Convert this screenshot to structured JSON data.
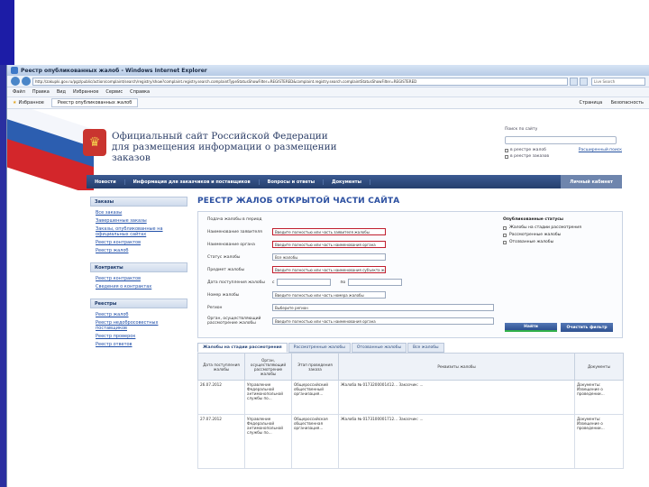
{
  "window": {
    "title": "Реестр опубликованных жалоб - Windows Internet Explorer",
    "address": "http://zakupki.gov.ru/pgz/public/action/complaint/search/registry/show?complaint.registry.search.complaintTypeStatusShowFilter=REGISTERED&complaint.registry.search.complaintStatusShowFilter=REGISTERED",
    "search_placeholder": "Live Search"
  },
  "menu": [
    "Файл",
    "Правка",
    "Вид",
    "Избранное",
    "Сервис",
    "Справка"
  ],
  "favbar": {
    "favorites": "Избранное",
    "tab": "Реестр опубликованных жалоб",
    "tools": [
      "Страница",
      "Безопасность"
    ]
  },
  "header": {
    "site_title": "Официальный сайт Российской Федерации для размещения информации о размещении заказов",
    "search_label": "Поиск по сайту",
    "opt1": "в реестре жалоб",
    "opt2": "в реестре заказов",
    "advanced_link": "Расширенный поиск"
  },
  "topnav": {
    "items": [
      "Новости",
      "Информация для заказчиков и поставщиков",
      "Вопросы и ответы",
      "Документы"
    ],
    "login": "Личный кабинет"
  },
  "sidebar": {
    "orders_head": "Заказы",
    "orders_links": [
      "Все заказы",
      "Завершенные заказы",
      "Заказы, опубликованные на официальных сайтах",
      "Реестр контрактов",
      "Реестр жалоб"
    ],
    "contracts_head": "Контракты",
    "contracts_links": [
      "Реестр контрактов",
      "Сведения о контрактах"
    ],
    "registries_head": "Реестры",
    "registries_links": [
      "Реестр жалоб",
      "Реестр недобросовестных поставщиков",
      "Реестр проверок",
      "Реестр ответов"
    ]
  },
  "main": {
    "title": "РЕЕСТР ЖАЛОБ ОТКРЫТОЙ ЧАСТИ САЙТА",
    "form": {
      "period_label": "Подача жалобы в период",
      "complainant_label": "Наименование заявителя",
      "complainant_value": "Введите полностью или часть заявителя жалобы",
      "authority_label": "Наименование органа",
      "authority_value": "Введите полностью или часть наименования органа",
      "status_label": "Статус жалобы",
      "status_value": "Все жалобы",
      "subject_label": "Предмет жалобы",
      "subject_value": "Введите полностью или часть наименования субъекта жалобы",
      "date_label": "Дата поступления жалобы",
      "date_from": "с",
      "date_to": "по",
      "number_label": "Номер жалобы",
      "number_value": "Введите полностью или часть номера жалобы",
      "region_label": "Регион",
      "region_value": "Выберите регион",
      "organ_label": "Орган, осуществляющий рассмотрение жалобы",
      "organ_value": "Введите полностью или часть наименования органа"
    },
    "status_panel": {
      "title": "Опубликованные статусы",
      "options": [
        "Жалобы на стадии рассмотрения",
        "Рассмотренные жалобы",
        "Отозванные жалобы"
      ]
    },
    "buttons": {
      "find": "Найти",
      "clear": "Очистить фильтр"
    },
    "tabs": [
      "Жалобы на стадии рассмотрения",
      "Рассмотренные жалобы",
      "Отозванные жалобы",
      "Все жалобы"
    ],
    "table": {
      "headers": [
        "Дата поступления жалобы",
        "Орган, осуществляющий рассмотрение жалобы",
        "Этап проведения заказа",
        "Реквизиты жалобы",
        "Документы"
      ],
      "rows": [
        {
          "date": "26.07.2012",
          "organ": "Управление Федеральной антимонопольной службы по...",
          "stage": "Общероссийский общественный организация...",
          "details": "Жалоба № 0173200001412... Заказчик: ...",
          "docs": "Документы: Извещение о проведении..."
        },
        {
          "date": "27.07.2012",
          "organ": "Управление Федеральной антимонопольной службы по...",
          "stage": "Общероссийская общественная организация...",
          "details": "Жалоба № 0173100001712... Заказчик: ...",
          "docs": "Документы: Извещение о проведении..."
        }
      ]
    }
  },
  "colors": {
    "nav": "#2b4a7e",
    "title": "#2b4fa0",
    "highlight": "#c01e2e",
    "button": "#3a5ea0"
  }
}
